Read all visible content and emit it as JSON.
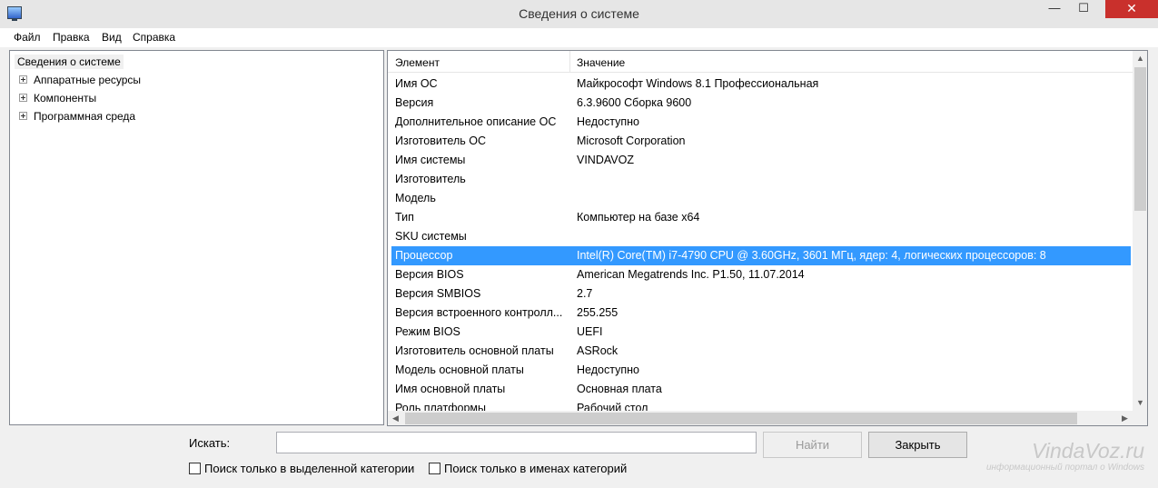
{
  "window": {
    "title": "Сведения о системе",
    "min_glyph": "—",
    "max_glyph": "☐",
    "close_glyph": "✕"
  },
  "menu": [
    "Файл",
    "Правка",
    "Вид",
    "Справка"
  ],
  "tree": {
    "root": "Сведения о системе",
    "children": [
      "Аппаратные ресурсы",
      "Компоненты",
      "Программная среда"
    ]
  },
  "list": {
    "headers": {
      "element": "Элемент",
      "value": "Значение"
    },
    "rows": [
      {
        "element": "Имя ОС",
        "value": "Майкрософт Windows 8.1 Профессиональная"
      },
      {
        "element": "Версия",
        "value": "6.3.9600 Сборка 9600"
      },
      {
        "element": "Дополнительное описание ОС",
        "value": "Недоступно"
      },
      {
        "element": "Изготовитель ОС",
        "value": "Microsoft Corporation"
      },
      {
        "element": "Имя системы",
        "value": "VINDAVOZ"
      },
      {
        "element": "Изготовитель",
        "value": ""
      },
      {
        "element": "Модель",
        "value": ""
      },
      {
        "element": "Тип",
        "value": "Компьютер на базе x64"
      },
      {
        "element": "SKU системы",
        "value": ""
      },
      {
        "element": "Процессор",
        "value": "Intel(R) Core(TM) i7-4790 CPU @ 3.60GHz, 3601 МГц, ядер: 4, логических процессоров: 8"
      },
      {
        "element": "Версия BIOS",
        "value": "American Megatrends Inc. P1.50, 11.07.2014"
      },
      {
        "element": "Версия SMBIOS",
        "value": "2.7"
      },
      {
        "element": "Версия встроенного контролл...",
        "value": "255.255"
      },
      {
        "element": "Режим BIOS",
        "value": "UEFI"
      },
      {
        "element": "Изготовитель основной платы",
        "value": "ASRock"
      },
      {
        "element": "Модель основной платы",
        "value": "Недоступно"
      },
      {
        "element": "Имя основной платы",
        "value": "Основная плата"
      },
      {
        "element": "Роль платформы",
        "value": "Рабочий стол"
      }
    ],
    "selected_row": "Процессор"
  },
  "search": {
    "label": "Искать:",
    "value": "",
    "find_button": "Найти",
    "close_button": "Закрыть",
    "option_selected_category": "Поиск только в выделенной категории",
    "option_category_names": "Поиск только в именах категорий"
  },
  "watermark": {
    "line1": "VindaVoz.ru",
    "line2": "информационный портал о Windows"
  },
  "colors": {
    "selection": "#3399ff",
    "close_button": "#c9302c"
  }
}
